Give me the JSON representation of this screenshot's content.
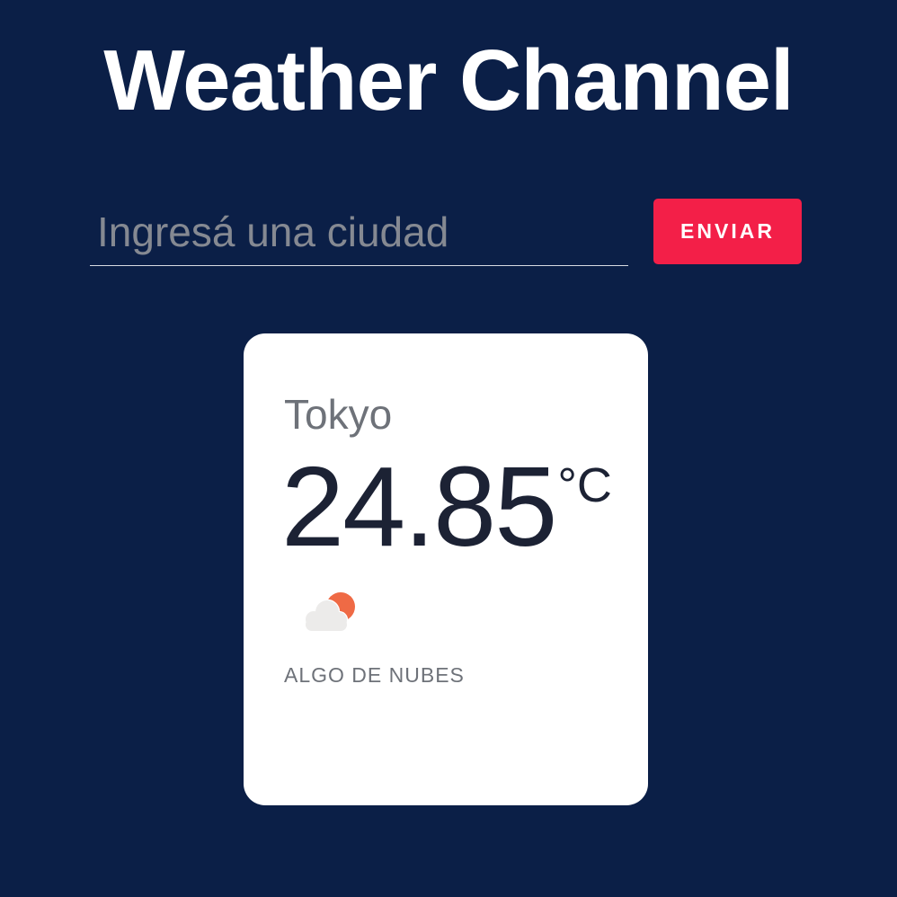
{
  "header": {
    "title": "Weather Channel"
  },
  "search": {
    "placeholder": "Ingresá una ciudad",
    "value": "",
    "submit_label": "ENVIAR"
  },
  "weather": {
    "city": "Tokyo",
    "temperature": "24.85",
    "unit": "°C",
    "icon": "partly-cloudy-icon",
    "description": "ALGO DE NUBES"
  },
  "colors": {
    "background": "#0b1f47",
    "accent": "#f31f48",
    "card": "#ffffff",
    "sun": "#ef6a45",
    "cloud": "#ecebea"
  }
}
